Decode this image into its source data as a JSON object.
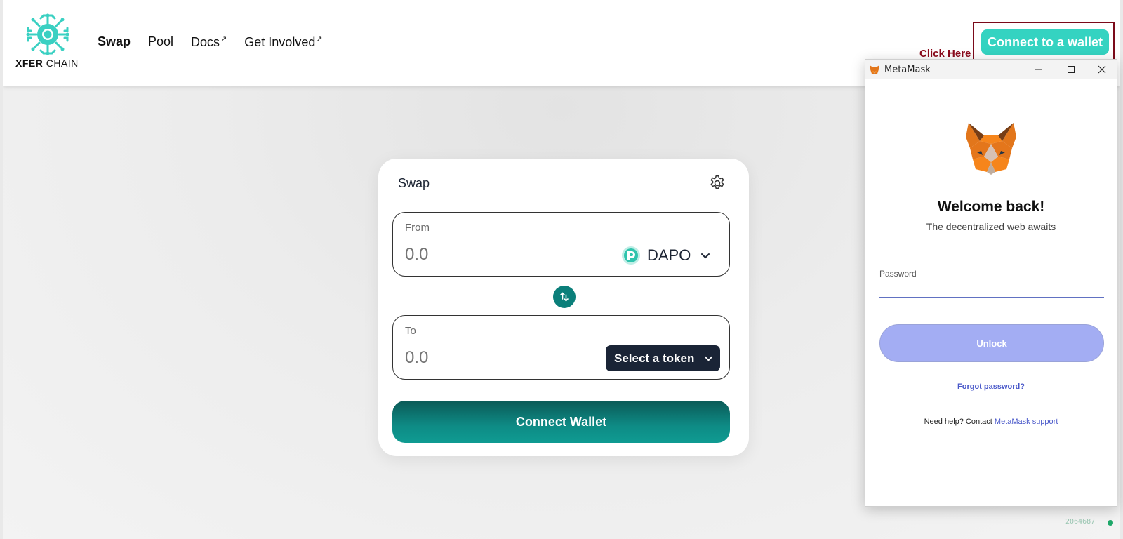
{
  "header": {
    "logo": {
      "brand_bold": "XFER",
      "brand_rest": "CHAIN"
    },
    "nav": [
      {
        "label": "Swap",
        "external": false,
        "active": true
      },
      {
        "label": "Pool",
        "external": false,
        "active": false
      },
      {
        "label": "Docs",
        "external": true,
        "active": false
      },
      {
        "label": "Get Involved",
        "external": true,
        "active": false
      }
    ],
    "external_marker": "↗",
    "connect_button": "Connect to a wallet",
    "annotation": "Click Here"
  },
  "swap": {
    "title": "Swap",
    "from": {
      "label": "From",
      "amount": "0.0",
      "token": "DAPO"
    },
    "to": {
      "label": "To",
      "amount": "0.0",
      "select_label": "Select a token"
    },
    "connect_wallet": "Connect Wallet"
  },
  "metamask": {
    "window_title": "MetaMask",
    "welcome": "Welcome back!",
    "subtitle": "The decentralized web awaits",
    "password_label": "Password",
    "password_value": "",
    "unlock": "Unlock",
    "forgot": "Forgot password?",
    "help_prefix": "Need help? Contact ",
    "help_link": "MetaMask support"
  },
  "footer": {
    "build": "2064687"
  },
  "colors": {
    "accent": "#34d3c1",
    "primary_teal": "#0b7f7a",
    "dark_navy": "#1a2436",
    "annotation_red": "#8b0a1c",
    "unlock_purple": "#a3adf3",
    "link_blue": "#4857c9"
  },
  "icons": [
    "xfer-logo-icon",
    "external-link-icon",
    "gear-icon",
    "dapo-token-icon",
    "chevron-down-icon",
    "swap-arrows-icon",
    "metamask-fox-icon",
    "minimize-icon",
    "maximize-icon",
    "close-icon",
    "status-dot-icon"
  ]
}
